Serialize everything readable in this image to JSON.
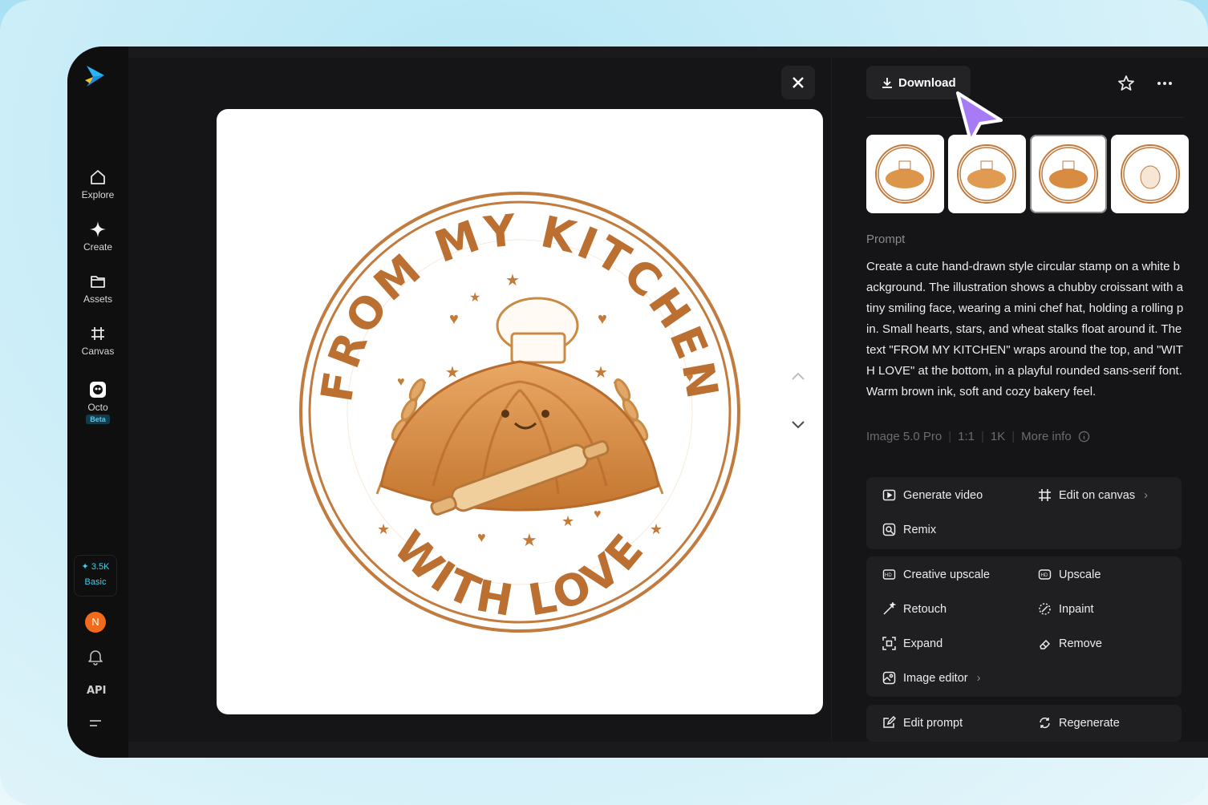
{
  "sidebar": {
    "items": [
      {
        "label": "Explore",
        "icon": "home-icon"
      },
      {
        "label": "Create",
        "icon": "sparkle-icon"
      },
      {
        "label": "Assets",
        "icon": "folder-icon"
      },
      {
        "label": "Canvas",
        "icon": "canvas-icon"
      },
      {
        "label": "Octo",
        "icon": "octo-icon",
        "badge": "Beta"
      }
    ],
    "credits": {
      "amount": "3.5K",
      "plan": "Basic"
    },
    "avatar_initial": "N",
    "api_label": "API"
  },
  "toolbar": {
    "download_label": "Download"
  },
  "image": {
    "stamp_top_text": "FROM MY KITCHEN",
    "stamp_bottom_text": "WITH LOVE"
  },
  "prompt": {
    "label": "Prompt",
    "text": "Create a cute hand-drawn style circular stamp on a white background. The illustration shows a chubby croissant with a tiny smiling face, wearing a mini chef hat, holding a rolling pin. Small hearts, stars, and wheat stalks float around it. The text \"FROM MY KITCHEN\" wraps around the top, and \"WITH LOVE\" at the bottom, in a playful rounded sans-serif font. Warm brown ink, soft and cozy bakery feel."
  },
  "meta": {
    "model": "Image 5.0 Pro",
    "ratio": "1:1",
    "resolution": "1K",
    "more_info": "More info"
  },
  "actions": {
    "generate_video": "Generate video",
    "edit_on_canvas": "Edit on canvas",
    "remix": "Remix",
    "creative_upscale": "Creative upscale",
    "upscale": "Upscale",
    "retouch": "Retouch",
    "inpaint": "Inpaint",
    "expand": "Expand",
    "remove": "Remove",
    "image_editor": "Image editor",
    "edit_prompt": "Edit prompt",
    "regenerate": "Regenerate"
  },
  "colors": {
    "accent": "#3fd0f0",
    "cursor": "#a77bf5",
    "stamp_ink": "#c0783a",
    "avatar": "#f26a1b"
  }
}
